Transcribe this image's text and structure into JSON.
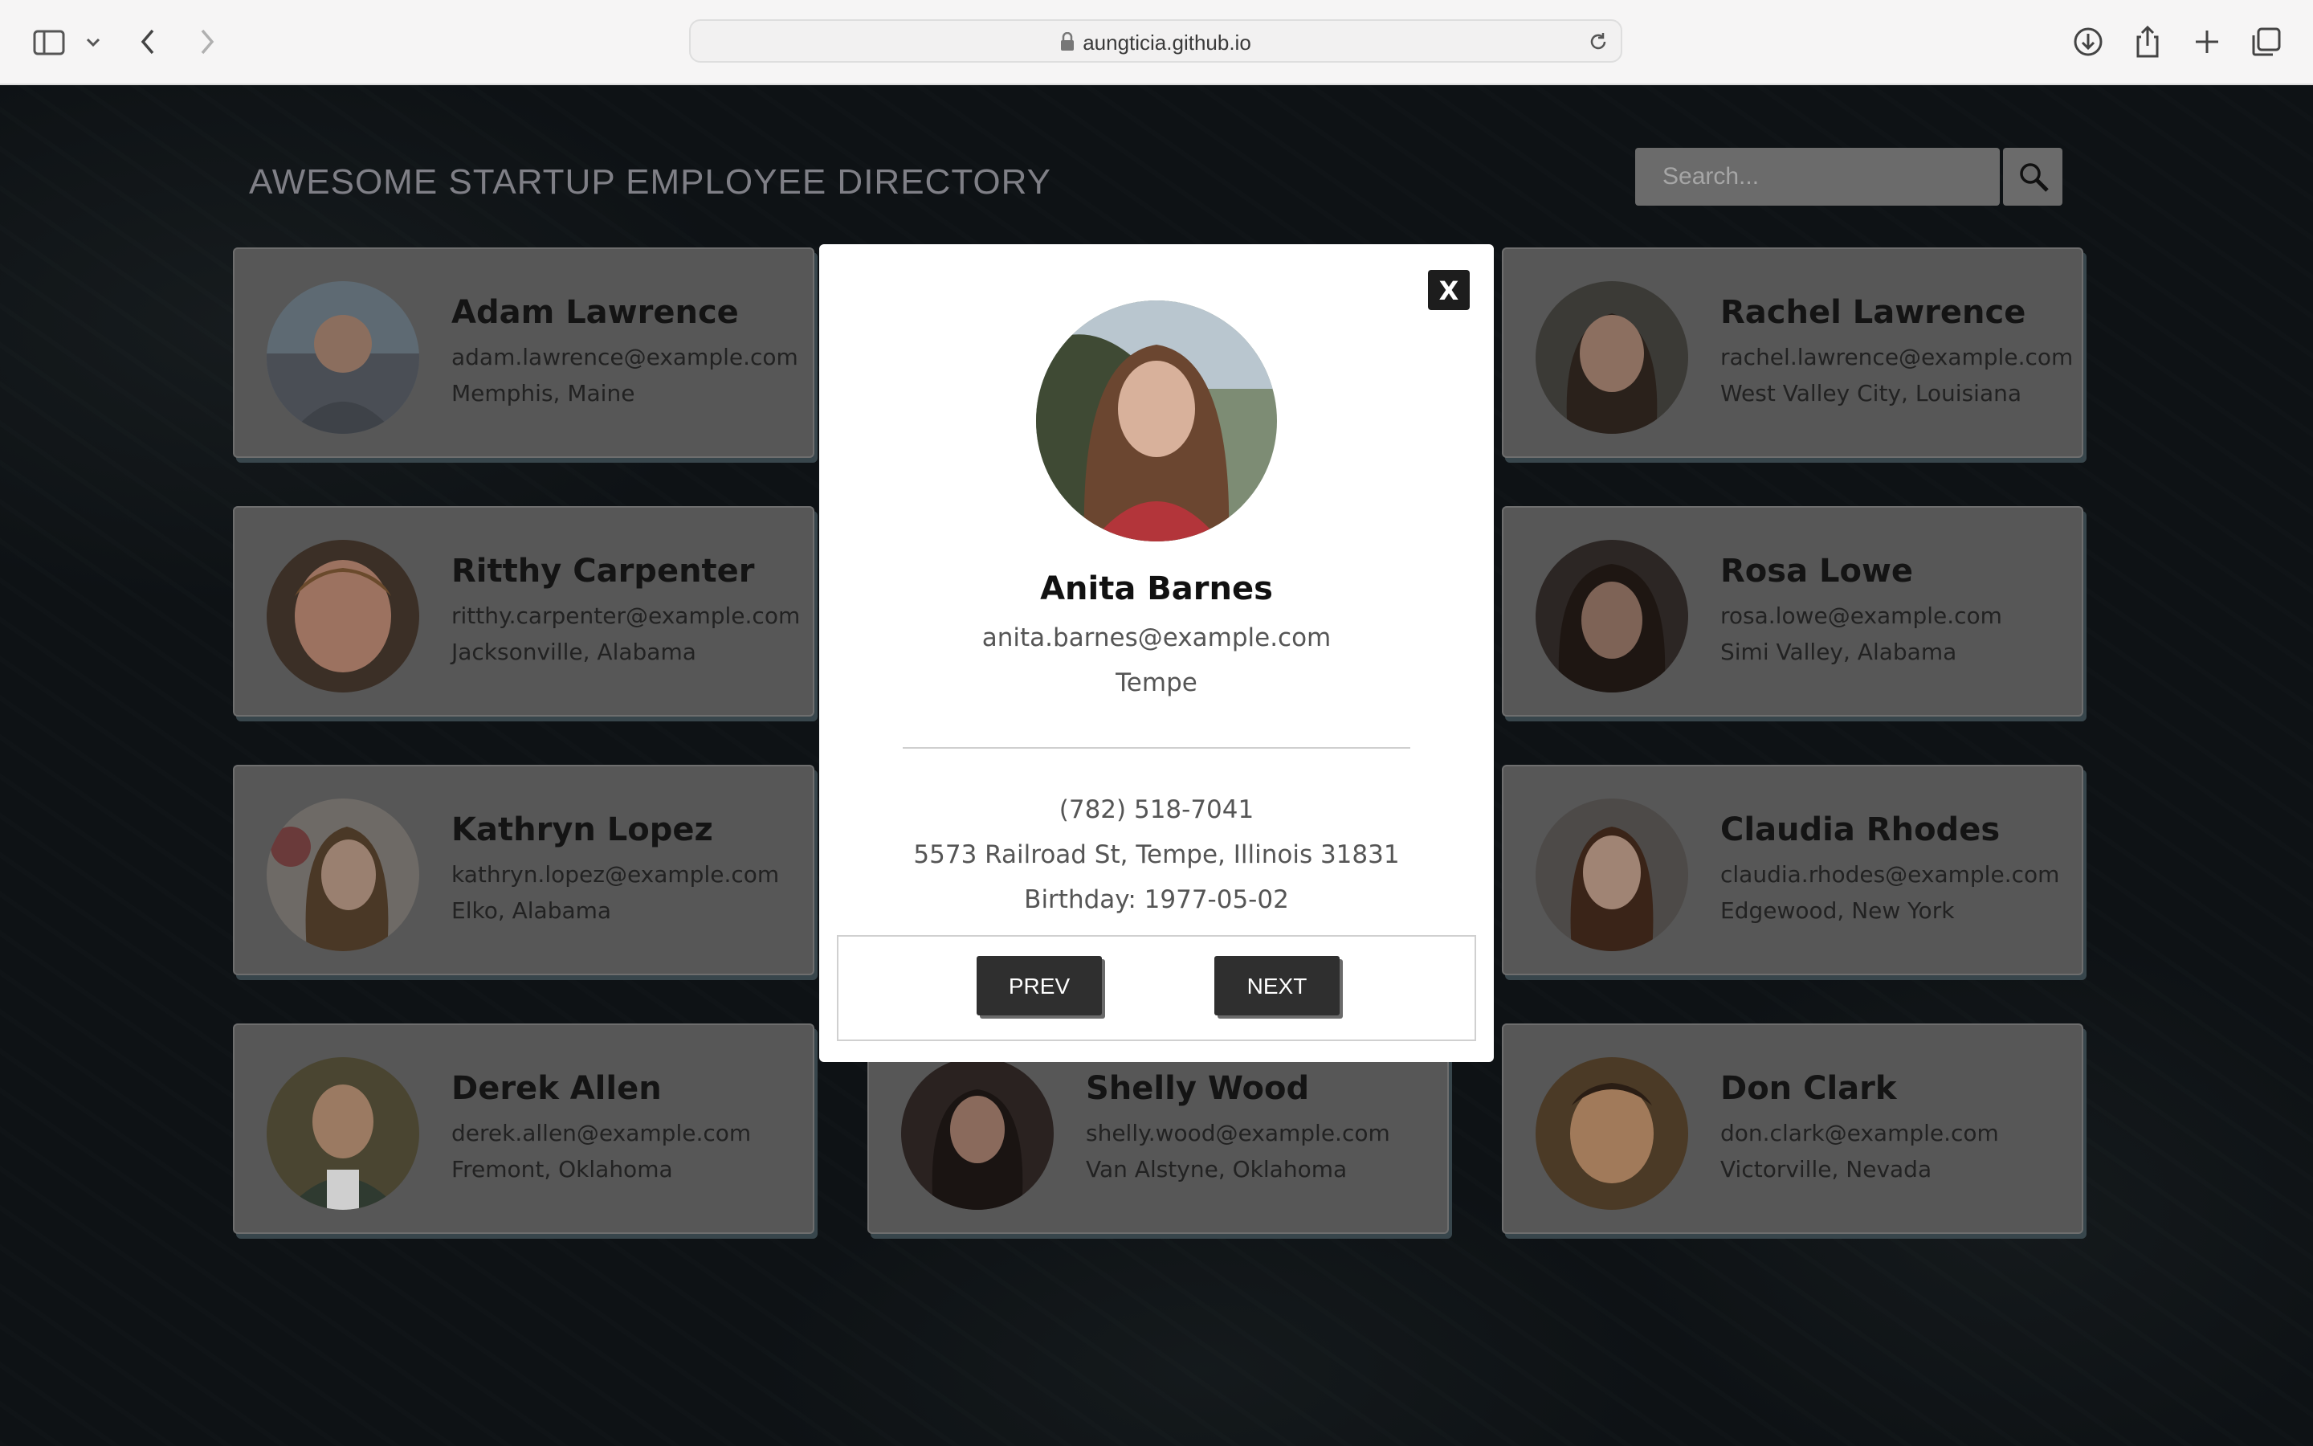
{
  "browser": {
    "url": "aungticia.github.io"
  },
  "page": {
    "title": "AWESOME STARTUP EMPLOYEE DIRECTORY",
    "search": {
      "placeholder": "Search..."
    }
  },
  "employees": [
    {
      "name": "Adam Lawrence",
      "email": "adam.lawrence@example.com",
      "location": "Memphis, Maine"
    },
    {
      "name": "Rachel Lawrence",
      "email": "rachel.lawrence@example.com",
      "location": "West Valley City, Louisiana"
    },
    {
      "name": "Ritthy Carpenter",
      "email": "ritthy.carpenter@example.com",
      "location": "Jacksonville, Alabama"
    },
    {
      "name": "Rosa Lowe",
      "email": "rosa.lowe@example.com",
      "location": "Simi Valley, Alabama"
    },
    {
      "name": "Kathryn Lopez",
      "email": "kathryn.lopez@example.com",
      "location": "Elko, Alabama"
    },
    {
      "name": "Claudia Rhodes",
      "email": "claudia.rhodes@example.com",
      "location": "Edgewood, New York"
    },
    {
      "name": "Derek Allen",
      "email": "derek.allen@example.com",
      "location": "Fremont, Oklahoma"
    },
    {
      "name": "Shelly Wood",
      "email": "shelly.wood@example.com",
      "location": "Van Alstyne, Oklahoma"
    },
    {
      "name": "Don Clark",
      "email": "don.clark@example.com",
      "location": "Victorville, Nevada"
    }
  ],
  "modal": {
    "close_label": "X",
    "name": "Anita Barnes",
    "email": "anita.barnes@example.com",
    "city": "Tempe",
    "phone": "(782) 518-7041",
    "address": "5573 Railroad St, Tempe, Illinois 31831",
    "birthday": "Birthday: 1977-05-02",
    "prev_label": "PREV",
    "next_label": "NEXT"
  }
}
